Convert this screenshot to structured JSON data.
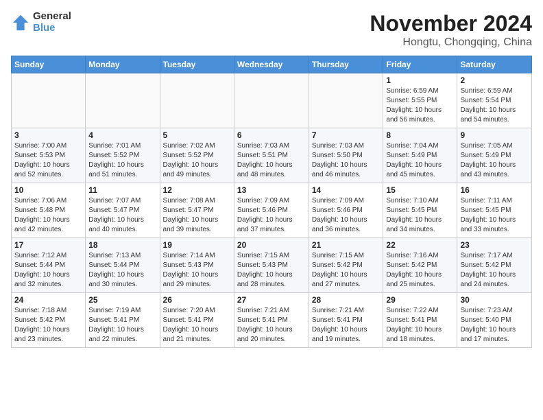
{
  "logo": {
    "general": "General",
    "blue": "Blue"
  },
  "header": {
    "month": "November 2024",
    "location": "Hongtu, Chongqing, China"
  },
  "weekdays": [
    "Sunday",
    "Monday",
    "Tuesday",
    "Wednesday",
    "Thursday",
    "Friday",
    "Saturday"
  ],
  "weeks": [
    [
      {
        "day": "",
        "info": ""
      },
      {
        "day": "",
        "info": ""
      },
      {
        "day": "",
        "info": ""
      },
      {
        "day": "",
        "info": ""
      },
      {
        "day": "",
        "info": ""
      },
      {
        "day": "1",
        "info": "Sunrise: 6:59 AM\nSunset: 5:55 PM\nDaylight: 10 hours and 56 minutes."
      },
      {
        "day": "2",
        "info": "Sunrise: 6:59 AM\nSunset: 5:54 PM\nDaylight: 10 hours and 54 minutes."
      }
    ],
    [
      {
        "day": "3",
        "info": "Sunrise: 7:00 AM\nSunset: 5:53 PM\nDaylight: 10 hours and 52 minutes."
      },
      {
        "day": "4",
        "info": "Sunrise: 7:01 AM\nSunset: 5:52 PM\nDaylight: 10 hours and 51 minutes."
      },
      {
        "day": "5",
        "info": "Sunrise: 7:02 AM\nSunset: 5:52 PM\nDaylight: 10 hours and 49 minutes."
      },
      {
        "day": "6",
        "info": "Sunrise: 7:03 AM\nSunset: 5:51 PM\nDaylight: 10 hours and 48 minutes."
      },
      {
        "day": "7",
        "info": "Sunrise: 7:03 AM\nSunset: 5:50 PM\nDaylight: 10 hours and 46 minutes."
      },
      {
        "day": "8",
        "info": "Sunrise: 7:04 AM\nSunset: 5:49 PM\nDaylight: 10 hours and 45 minutes."
      },
      {
        "day": "9",
        "info": "Sunrise: 7:05 AM\nSunset: 5:49 PM\nDaylight: 10 hours and 43 minutes."
      }
    ],
    [
      {
        "day": "10",
        "info": "Sunrise: 7:06 AM\nSunset: 5:48 PM\nDaylight: 10 hours and 42 minutes."
      },
      {
        "day": "11",
        "info": "Sunrise: 7:07 AM\nSunset: 5:47 PM\nDaylight: 10 hours and 40 minutes."
      },
      {
        "day": "12",
        "info": "Sunrise: 7:08 AM\nSunset: 5:47 PM\nDaylight: 10 hours and 39 minutes."
      },
      {
        "day": "13",
        "info": "Sunrise: 7:09 AM\nSunset: 5:46 PM\nDaylight: 10 hours and 37 minutes."
      },
      {
        "day": "14",
        "info": "Sunrise: 7:09 AM\nSunset: 5:46 PM\nDaylight: 10 hours and 36 minutes."
      },
      {
        "day": "15",
        "info": "Sunrise: 7:10 AM\nSunset: 5:45 PM\nDaylight: 10 hours and 34 minutes."
      },
      {
        "day": "16",
        "info": "Sunrise: 7:11 AM\nSunset: 5:45 PM\nDaylight: 10 hours and 33 minutes."
      }
    ],
    [
      {
        "day": "17",
        "info": "Sunrise: 7:12 AM\nSunset: 5:44 PM\nDaylight: 10 hours and 32 minutes."
      },
      {
        "day": "18",
        "info": "Sunrise: 7:13 AM\nSunset: 5:44 PM\nDaylight: 10 hours and 30 minutes."
      },
      {
        "day": "19",
        "info": "Sunrise: 7:14 AM\nSunset: 5:43 PM\nDaylight: 10 hours and 29 minutes."
      },
      {
        "day": "20",
        "info": "Sunrise: 7:15 AM\nSunset: 5:43 PM\nDaylight: 10 hours and 28 minutes."
      },
      {
        "day": "21",
        "info": "Sunrise: 7:15 AM\nSunset: 5:42 PM\nDaylight: 10 hours and 27 minutes."
      },
      {
        "day": "22",
        "info": "Sunrise: 7:16 AM\nSunset: 5:42 PM\nDaylight: 10 hours and 25 minutes."
      },
      {
        "day": "23",
        "info": "Sunrise: 7:17 AM\nSunset: 5:42 PM\nDaylight: 10 hours and 24 minutes."
      }
    ],
    [
      {
        "day": "24",
        "info": "Sunrise: 7:18 AM\nSunset: 5:42 PM\nDaylight: 10 hours and 23 minutes."
      },
      {
        "day": "25",
        "info": "Sunrise: 7:19 AM\nSunset: 5:41 PM\nDaylight: 10 hours and 22 minutes."
      },
      {
        "day": "26",
        "info": "Sunrise: 7:20 AM\nSunset: 5:41 PM\nDaylight: 10 hours and 21 minutes."
      },
      {
        "day": "27",
        "info": "Sunrise: 7:21 AM\nSunset: 5:41 PM\nDaylight: 10 hours and 20 minutes."
      },
      {
        "day": "28",
        "info": "Sunrise: 7:21 AM\nSunset: 5:41 PM\nDaylight: 10 hours and 19 minutes."
      },
      {
        "day": "29",
        "info": "Sunrise: 7:22 AM\nSunset: 5:41 PM\nDaylight: 10 hours and 18 minutes."
      },
      {
        "day": "30",
        "info": "Sunrise: 7:23 AM\nSunset: 5:40 PM\nDaylight: 10 hours and 17 minutes."
      }
    ]
  ]
}
